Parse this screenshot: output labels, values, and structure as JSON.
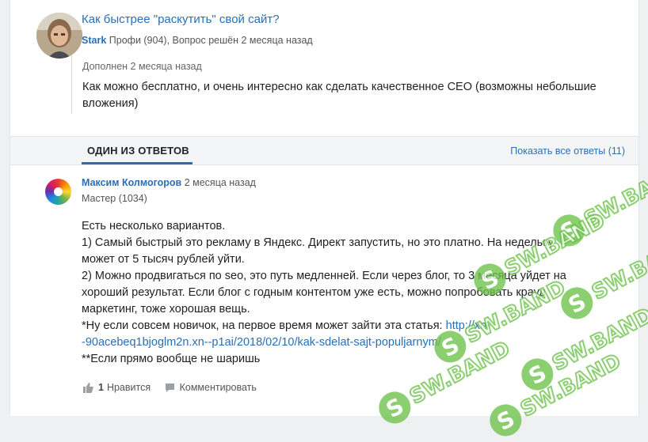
{
  "question": {
    "title": "Как быстрее \"раскутить\" свой сайт?",
    "author": "Stark",
    "meta": "Профи (904), Вопрос решён 2 месяца назад",
    "addition_label": "Дополнен 2 месяца назад",
    "addition_text": "Как можно бесплатно, и очень интересно как сделать качественное СЕО (возможны небольшие вложения)"
  },
  "answers_bar": {
    "title": "ОДИН ИЗ ОТВЕТОВ",
    "show_all": "Показать все ответы (11)"
  },
  "answer": {
    "author": "Максим Колмогоров",
    "time": "2 месяца назад",
    "rank": "Мастер (1034)",
    "lines": [
      "Есть несколько вариантов.",
      "1) Самый быстрый это рекламу в Яндекс. Директ запустить, но это платно. На недельку",
      "может от 5 тысяч рублей уйти.",
      "2) Можно продвигаться по seo, это путь медленней. Если через блог, то 3 месяца уйдет на",
      "хороший результат. Если блог с годным контентом уже есть, можно попробовать крауд",
      "маркетинг, тоже хорошая вещь."
    ],
    "link_prefix": "*Ну если совсем новичок, на первое время может зайти эта статья: ",
    "link_part1": "http://xn-",
    "link_part2": "-90acebeq1bjoglm2n.xn--p1ai/2018/02/10/kak-sdelat-sajt-populjarnym/",
    "last_line": "**Если прямо вообще не шаришь",
    "likes_count": "1",
    "like_label": "Нравится",
    "comment_label": "Комментировать"
  },
  "watermark": {
    "text": "SW.BAND",
    "logo_letter": "S",
    "color": "#6cc24a"
  }
}
